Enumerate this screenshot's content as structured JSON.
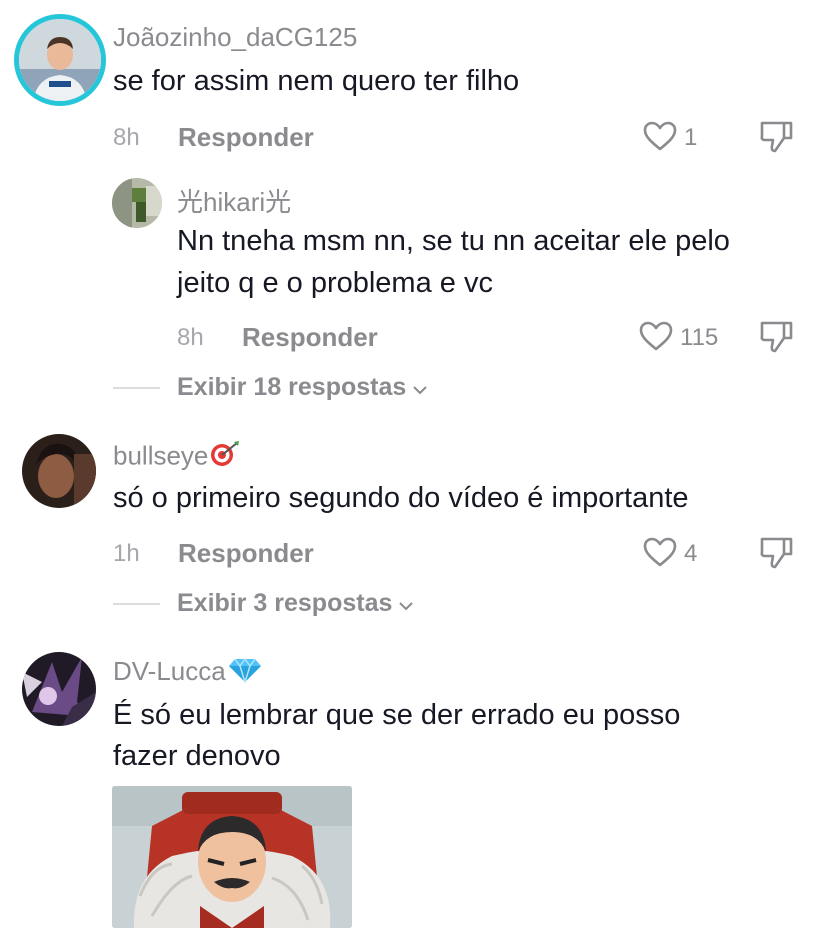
{
  "comments": [
    {
      "username": "Joãozinho_daCG125",
      "text": "se for assim nem quero ter filho",
      "time": "8h",
      "reply_label": "Responder",
      "likes": "1",
      "replies": [
        {
          "username": "光hikari光",
          "text_lines": [
            "Nn tneha msm nn, se tu nn aceitar ele pelo",
            "jeito q e o problema e vc"
          ],
          "time": "8h",
          "reply_label": "Responder",
          "likes": "115"
        }
      ],
      "view_more": "Exibir 18 respostas"
    },
    {
      "username": "bullseye",
      "username_emoji": "dart-emoji",
      "text": "só o primeiro segundo do vídeo é importante",
      "time": "1h",
      "reply_label": "Responder",
      "likes": "4",
      "view_more": "Exibir 3 respostas"
    },
    {
      "username": "DV-Lucca",
      "username_emoji": "gem-emoji",
      "text_lines": [
        "É só eu lembrar que se der errado eu posso",
        "fazer denovo"
      ],
      "attachment": "meme-image"
    }
  ],
  "colors": {
    "text": "#161823",
    "secondary": "#8a8a8f",
    "story_ring": "#26c6da"
  },
  "icons": [
    "heart-icon",
    "dislike-icon",
    "chevron-down-icon"
  ]
}
